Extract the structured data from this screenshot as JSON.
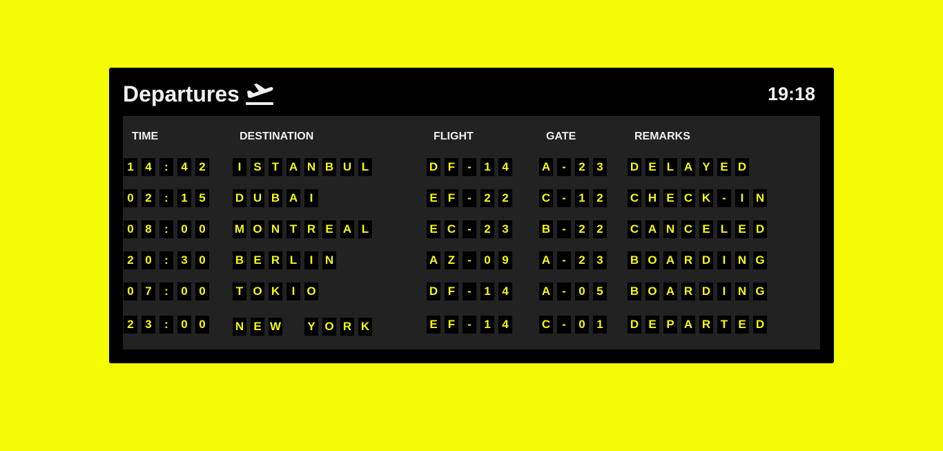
{
  "header": {
    "title": "Departures",
    "clock": "19:18"
  },
  "icons": {
    "departures": "airplane-departure-icon"
  },
  "colors": {
    "background": "#f5fa05",
    "board": "#000000",
    "panel": "#222222",
    "flap_text": "#f5fa05",
    "label_text": "#f0f0f0"
  },
  "columns": {
    "time": "TIME",
    "destination": "DESTINATION",
    "flight": "FLIGHT",
    "gate": "GATE",
    "remarks": "REMARKS"
  },
  "flights": [
    {
      "time": "14:42",
      "destination": "ISTANBUL",
      "flight": "DF-14",
      "gate": "A-23",
      "remarks": "DELAYED"
    },
    {
      "time": "02:15",
      "destination": "DUBAI",
      "flight": "EF-22",
      "gate": "C-12",
      "remarks": "CHECK-IN"
    },
    {
      "time": "08:00",
      "destination": "MONTREAL",
      "flight": "EC-23",
      "gate": "B-22",
      "remarks": "CANCELED"
    },
    {
      "time": "20:30",
      "destination": "BERLIN",
      "flight": "AZ-09",
      "gate": "A-23",
      "remarks": "BOARDING"
    },
    {
      "time": "07:00",
      "destination": "TOKIO",
      "flight": "DF-14",
      "gate": "A-05",
      "remarks": "BOARDING"
    },
    {
      "time": "23:00",
      "destination": "NEW YORK",
      "flight": "EF-14",
      "gate": "C-01",
      "remarks": "DEPARTED"
    }
  ]
}
